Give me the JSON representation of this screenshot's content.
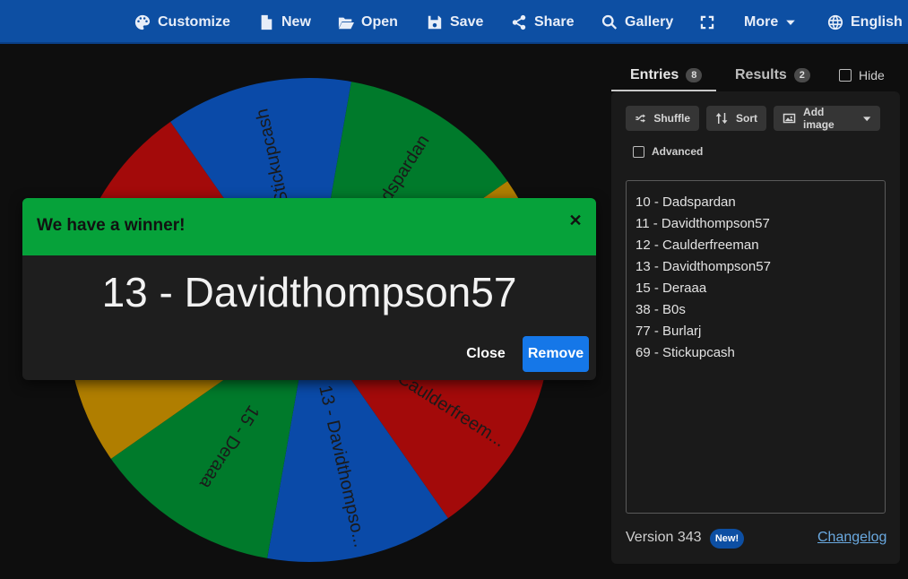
{
  "nav": {
    "customize": "Customize",
    "new": "New",
    "open": "Open",
    "save": "Save",
    "share": "Share",
    "gallery": "Gallery",
    "more": "More",
    "language": "English"
  },
  "wheel": {
    "colors": [
      "#007a2b",
      "#b07e00",
      "#a30a0a",
      "#0a4aa8"
    ],
    "segment_labels": [
      "10 - Dadspardan",
      "11 - Davidthompso...",
      "12 - Caulderfreem...",
      "13 - Davidthompso...",
      "15 - Deraaa",
      "38 - B0s",
      "77 - Burlarj",
      "69 - Stickupcash"
    ]
  },
  "sidebar": {
    "tabs": [
      {
        "label": "Entries",
        "count": "8"
      },
      {
        "label": "Results",
        "count": "2"
      }
    ],
    "hide_label": "Hide",
    "shuffle": "Shuffle",
    "sort": "Sort",
    "add_image": "Add image",
    "advanced": "Advanced",
    "entries": [
      "10 - Dadspardan",
      "11 - Davidthompson57",
      "12 - Caulderfreeman",
      "13 - Davidthompson57",
      "15 - Deraaa",
      "38 - B0s",
      "77 - Burlarj",
      "69 - Stickupcash"
    ],
    "version": "Version 343",
    "new_badge": "New!",
    "changelog": "Changelog"
  },
  "dialog": {
    "title": "We have a winner!",
    "winner": "13 - Davidthompson57",
    "close": "Close",
    "remove": "Remove"
  }
}
